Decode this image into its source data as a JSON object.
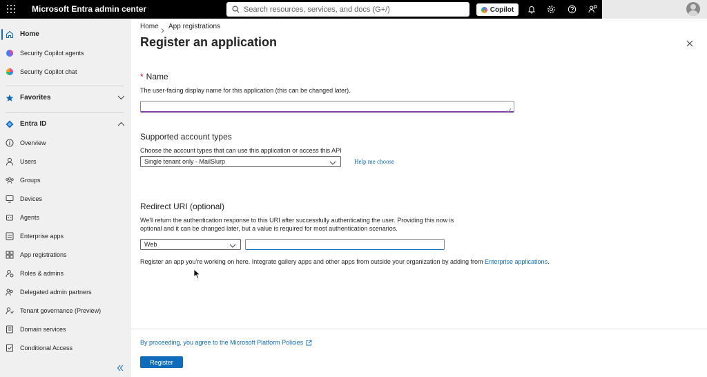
{
  "topbar": {
    "title": "Microsoft Entra admin center",
    "search_placeholder": "Search resources, services, and docs (G+/)",
    "copilot_label": "Copilot"
  },
  "sidebar": {
    "items": [
      {
        "label": "Home",
        "icon": "home-icon"
      },
      {
        "label": "Security Copilot agents",
        "icon": "copilot-agents-icon"
      },
      {
        "label": "Security Copilot chat",
        "icon": "copilot-chat-icon"
      },
      {
        "label": "Favorites",
        "icon": "star-icon"
      },
      {
        "label": "Entra ID",
        "icon": "entra-id-icon"
      },
      {
        "label": "Overview",
        "icon": "info-icon"
      },
      {
        "label": "Users",
        "icon": "user-icon"
      },
      {
        "label": "Groups",
        "icon": "groups-icon"
      },
      {
        "label": "Devices",
        "icon": "devices-icon"
      },
      {
        "label": "Agents",
        "icon": "agents-icon"
      },
      {
        "label": "Enterprise apps",
        "icon": "enterprise-apps-icon"
      },
      {
        "label": "App registrations",
        "icon": "app-registrations-icon"
      },
      {
        "label": "Roles & admins",
        "icon": "roles-icon"
      },
      {
        "label": "Delegated admin partners",
        "icon": "partners-icon"
      },
      {
        "label": "Tenant governance (Preview)",
        "icon": "tenant-governance-icon"
      },
      {
        "label": "Domain services",
        "icon": "domain-services-icon"
      },
      {
        "label": "Conditional Access",
        "icon": "conditional-access-icon"
      }
    ]
  },
  "breadcrumb": {
    "home": "Home",
    "current": "App registrations"
  },
  "page": {
    "title": "Register an application",
    "more": "..."
  },
  "name_section": {
    "required_mark": "*",
    "title": "Name",
    "description": "The user-facing display name for this application (this can be changed later).",
    "value": ""
  },
  "account_types": {
    "title": "Supported account types",
    "description": "Choose the account types that can use this application or access this API",
    "selected": "Single tenant only - MailSlurp",
    "help_link": "Help me choose"
  },
  "redirect": {
    "title": "Redirect URI (optional)",
    "description_line1": "We'll return the authentication response to this URI after successfully authenticating the user. Providing this now is",
    "description_line2": "optional and it can be changed later, but a value is required for most authentication scenarios.",
    "platform_selected": "Web",
    "uri_value": ""
  },
  "info": {
    "text": "Register an app you're working on here. Integrate gallery apps and other apps from outside your organization by adding from ",
    "link": "Enterprise applications",
    "suffix": "."
  },
  "footer": {
    "policy_link": "By proceeding, you agree to the Microsoft Platform Policies",
    "register_label": "Register"
  },
  "colors": {
    "accent": "#0f6cbd",
    "topbar": "#000000",
    "sidebar": "#f0f0f0",
    "required": "#c50f1f"
  }
}
